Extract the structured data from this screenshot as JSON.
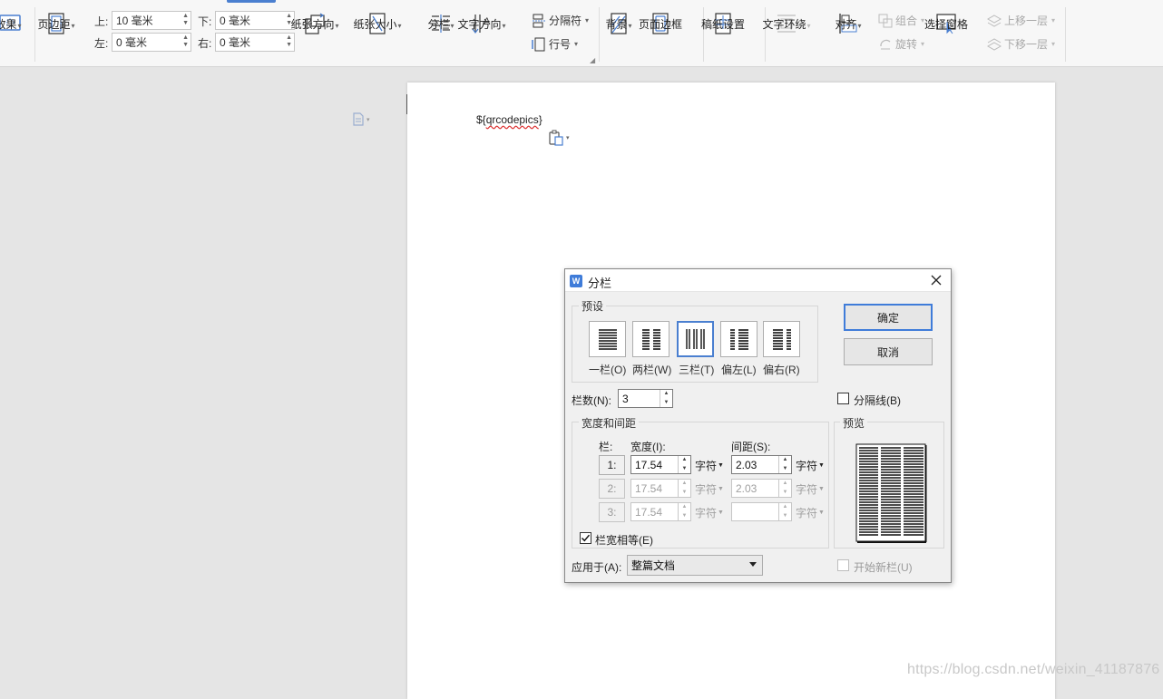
{
  "ribbon": {
    "effects_label": "效果",
    "page_margin_label": "页边距",
    "margin_top_label": "上:",
    "margin_top_value": "10 毫米",
    "margin_bottom_label": "下:",
    "margin_bottom_value": "0 毫米",
    "margin_left_label": "左:",
    "margin_left_value": "0 毫米",
    "margin_right_label": "右:",
    "margin_right_value": "0 毫米",
    "orientation_label": "纸张方向",
    "size_label": "纸张大小",
    "columns_label": "分栏",
    "text_direction_label": "文字方向",
    "separator_label": "分隔符",
    "line_number_label": "行号",
    "background_label": "背景",
    "page_border_label": "页面边框",
    "manuscript_label": "稿纸设置",
    "text_wrap_label": "文字环绕",
    "align_label": "对齐",
    "group_label": "组合",
    "rotate_label": "旋转",
    "selection_pane_label": "选择窗格",
    "bring_forward_label": "上移一层",
    "send_backward_label": "下移一层"
  },
  "document": {
    "text_prefix": "${",
    "text_word": "qrcodepics",
    "text_suffix": "}"
  },
  "dialog": {
    "title": "分栏",
    "preset_group_title": "预设",
    "presets": [
      {
        "label": "一栏(O)"
      },
      {
        "label": "两栏(W)"
      },
      {
        "label": "三栏(T)"
      },
      {
        "label": "偏左(L)"
      },
      {
        "label": "偏右(R)"
      }
    ],
    "selected_preset": "三栏(T)",
    "ok_label": "确定",
    "cancel_label": "取消",
    "num_columns_label": "栏数(N):",
    "num_columns_value": "3",
    "divider_label": "分隔线(B)",
    "width_group_title": "宽度和间距",
    "col_header": "栏:",
    "width_header": "宽度(I):",
    "spacing_header": "间距(S):",
    "unit": "字符",
    "rows": [
      {
        "index": "1:",
        "width": "17.54",
        "spacing": "2.03"
      },
      {
        "index": "2:",
        "width": "17.54",
        "spacing": "2.03"
      },
      {
        "index": "3:",
        "width": "17.54",
        "spacing": ""
      }
    ],
    "equal_width_label": "栏宽相等(E)",
    "equal_width_checked": true,
    "preview_title": "预览",
    "apply_to_label": "应用于(A):",
    "apply_to_value": "整篇文档",
    "new_column_label": "开始新栏(U)"
  },
  "watermark": "https://blog.csdn.net/weixin_41187876",
  "colors": {
    "accent": "#3f7cd9",
    "page_bg": "#e5e5e5",
    "dialog_bg": "#f0f0f0"
  }
}
